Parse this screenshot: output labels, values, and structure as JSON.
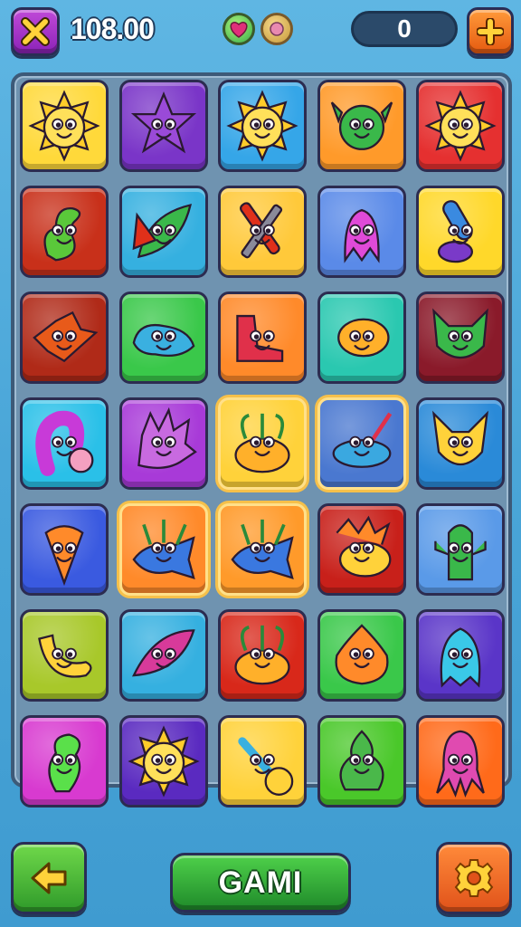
{
  "header": {
    "score": "108.00",
    "counter": "0",
    "close_icon": "close-x-icon",
    "plus_icon": "plus-icon",
    "heart_icon": "heart-orb-icon",
    "gem_icon": "gem-orb-icon"
  },
  "footer": {
    "game_label": "GAMI",
    "back_icon": "arrow-left-icon",
    "settings_icon": "gear-icon"
  },
  "board": {
    "rows": 7,
    "cols": 5,
    "tiles": [
      [
        "sun-face",
        "star-face",
        "sun-face",
        "cactus-face",
        "sun-face"
      ],
      [
        "dinosaur",
        "leaf-creature",
        "crossed-tools",
        "pink-creature",
        "magnifier-snail"
      ],
      [
        "fox-fish",
        "slug",
        "boot-tool",
        "puffer-fish",
        "cat-face"
      ],
      [
        "snake-spiral",
        "hedgehog",
        "plant-bug",
        "narwhal",
        "fox-face"
      ],
      [
        "carrot",
        "plant-fish",
        "plant-fish",
        "lion-fish",
        "cactus-creature"
      ],
      [
        "banana-creature",
        "leaf-bird",
        "plant-bug",
        "flame-face",
        "ghost-creature"
      ],
      [
        "seahorse",
        "sun-face",
        "bone-bug",
        "pear-creature",
        "squid"
      ]
    ],
    "tile_colors": [
      [
        "#ffd93a",
        "#7a35c8",
        "#35a6e8",
        "#ff9a2a",
        "#e53030"
      ],
      [
        "#c8301a",
        "#35b0e0",
        "#ffc93a",
        "#5a8ae8",
        "#ffd82a"
      ],
      [
        "#b02a18",
        "#3ac84a",
        "#ff8a2a",
        "#2ac8b0",
        "#8a1a2a"
      ],
      [
        "#2ac0e8",
        "#a83ad8",
        "#ffd23a",
        "#4a78d0",
        "#2a8ad8"
      ],
      [
        "#3a5ae0",
        "#ff8a2a",
        "#ff9a2a",
        "#c8201a",
        "#5a9ae8"
      ],
      [
        "#a8c82a",
        "#35b0e0",
        "#d8281a",
        "#3ac84a",
        "#5a35c8"
      ],
      [
        "#d83ad0",
        "#5a2ac0",
        "#ffd23a",
        "#4ac82a",
        "#ff6a1a"
      ]
    ],
    "selected": [
      [
        3,
        2
      ],
      [
        3,
        3
      ],
      [
        4,
        1
      ],
      [
        4,
        2
      ]
    ]
  }
}
